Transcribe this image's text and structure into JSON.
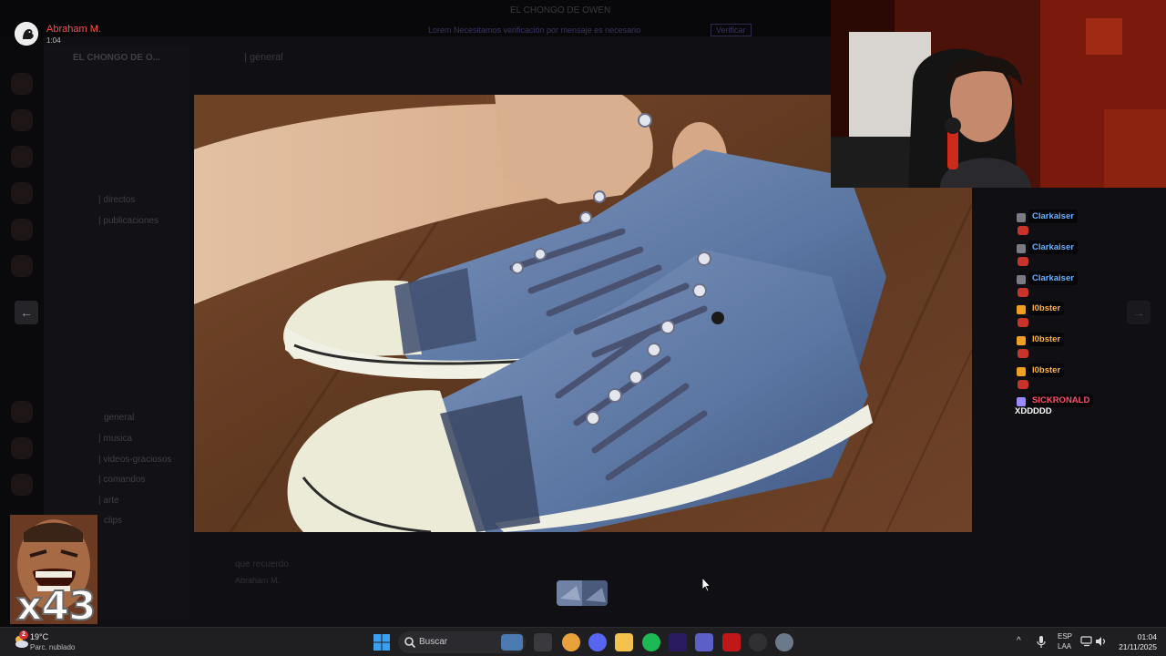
{
  "viewer": {
    "uploader_name": "Abraham M.",
    "upload_time": "1:04"
  },
  "discord_background": {
    "server_title": "EL CHONGO DE OWEN",
    "notice_text": "Lorem Necesitamos verificación por mensaje es necesario",
    "notice_button": "Verificar",
    "channel_header": "| general",
    "sidebar_server_name": "EL CHONGO DE O...",
    "channels": [
      "| directos",
      "| publicaciones",
      "general",
      "| musica",
      "| videos-graciosos",
      "| comandos",
      "| arte",
      "clips"
    ],
    "message_preview": "que recuerdo",
    "reply_author": "Abraham M."
  },
  "stream_chat": {
    "messages": [
      {
        "user": "Clarkaiser",
        "color": "#6fb0ff",
        "badge_color": "#7b7b85"
      },
      {
        "user": "Clarkaiser",
        "color": "#6fb0ff",
        "badge_color": "#7b7b85"
      },
      {
        "user": "Clarkaiser",
        "color": "#6fb0ff",
        "badge_color": "#7b7b85"
      },
      {
        "user": "l0bster",
        "color": "#ffb347",
        "badge_color": "#f0a020"
      },
      {
        "user": "l0bster",
        "color": "#ffb347",
        "badge_color": "#f0a020"
      },
      {
        "user": "l0bster",
        "color": "#ffb347",
        "badge_color": "#f0a020"
      },
      {
        "user": "SICKRONALD",
        "color": "#ff4d6d",
        "badge_color": "#9a8cff"
      }
    ],
    "last_message_text": "XDDDDD"
  },
  "overlay": {
    "meme_counter": "x43"
  },
  "taskbar": {
    "weather_temp": "19°C",
    "weather_desc": "Parc. nublado",
    "weather_badge": "2",
    "search_placeholder": "Buscar",
    "apps": [
      {
        "icon": "file-manager-icon",
        "color": "#3a3a3e"
      },
      {
        "icon": "chrome-icon",
        "color": "#e9a23b"
      },
      {
        "icon": "discord-icon",
        "color": "#5865f2"
      },
      {
        "icon": "folder-icon",
        "color": "#f2c14e"
      },
      {
        "icon": "spotify-icon",
        "color": "#1db954"
      },
      {
        "icon": "premiere-icon",
        "color": "#2a1a5e"
      },
      {
        "icon": "teams-icon",
        "color": "#5b5fc7"
      },
      {
        "icon": "mcafee-icon",
        "color": "#c01818"
      },
      {
        "icon": "obs-icon",
        "color": "#303033"
      },
      {
        "icon": "settings-icon",
        "color": "#6b7a8a"
      }
    ],
    "language": "ESP",
    "keyboard": "LAA",
    "time": "01:04",
    "date": "21/11/2025"
  },
  "colors": {
    "accent_red": "#ff4b4b",
    "taskbar_bg": "#1f1f22"
  }
}
